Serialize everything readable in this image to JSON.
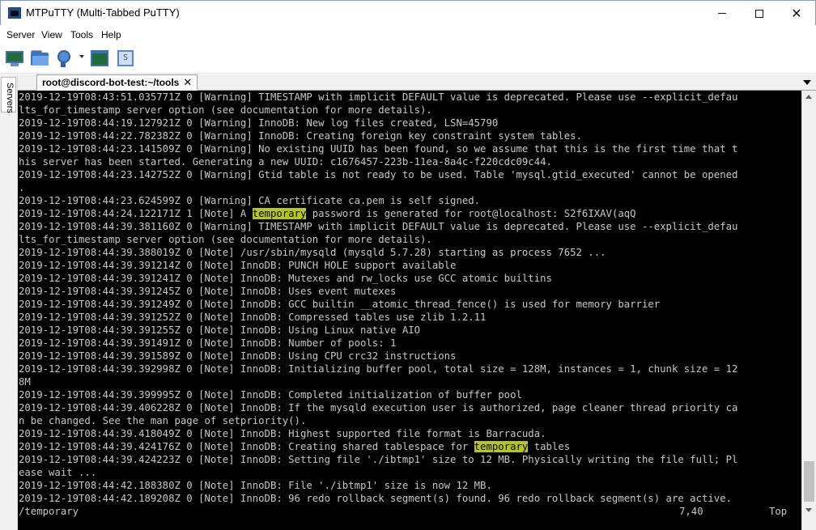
{
  "window": {
    "title": "MTPuTTY (Multi-Tabbed PuTTY)",
    "minimize_icon": "minimize-icon",
    "maximize_icon": "maximize-icon",
    "close_glyph": "✕"
  },
  "menu": {
    "items": [
      "Server",
      "View",
      "Tools",
      "Help"
    ]
  },
  "toolbar": {
    "icons": [
      "monitor-icon",
      "folder-icon",
      "connect-icon",
      "dropdown-arrow-icon",
      "terminal-icon",
      "script-icon"
    ],
    "script_glyph": "S"
  },
  "sidebar": {
    "servers_label": "Servers"
  },
  "tab": {
    "label": "root@discord-bot-test:~/tools",
    "close_glyph": "✕"
  },
  "terminal": {
    "highlight_color": "#b7c61a",
    "lines": [
      {
        "pre": "2019-12-19T08:43:51.035771Z 0 [Warning] TIMESTAMP with implicit DEFAULT value is deprecated. Please use --explicit_defau",
        "hl": "",
        "post": ""
      },
      {
        "pre": "lts_for_timestamp server option (see documentation for more details).",
        "hl": "",
        "post": ""
      },
      {
        "pre": "2019-12-19T08:44:19.127921Z 0 [Warning] InnoDB: New log files created, LSN=45790",
        "hl": "",
        "post": ""
      },
      {
        "pre": "2019-12-19T08:44:22.782382Z 0 [Warning] InnoDB: Creating foreign key constraint system tables.",
        "hl": "",
        "post": ""
      },
      {
        "pre": "2019-12-19T08:44:23.141509Z 0 [Warning] No existing UUID has been found, so we assume that this is the first time that t",
        "hl": "",
        "post": ""
      },
      {
        "pre": "his server has been started. Generating a new UUID: c1676457-223b-11ea-8a4c-f220cdc09c44.",
        "hl": "",
        "post": ""
      },
      {
        "pre": "2019-12-19T08:44:23.142752Z 0 [Warning] Gtid table is not ready to be used. Table 'mysql.gtid_executed' cannot be opened",
        "hl": "",
        "post": ""
      },
      {
        "pre": ".",
        "hl": "",
        "post": ""
      },
      {
        "pre": "2019-12-19T08:44:23.624599Z 0 [Warning] CA certificate ca.pem is self signed.",
        "hl": "",
        "post": ""
      },
      {
        "pre": "2019-12-19T08:44:24.122171Z 1 [Note] A ",
        "hl": "temporary",
        "post": " password is generated for root@localhost: S2f6IXAV(aqQ"
      },
      {
        "pre": "2019-12-19T08:44:39.381160Z 0 [Warning] TIMESTAMP with implicit DEFAULT value is deprecated. Please use --explicit_defau",
        "hl": "",
        "post": ""
      },
      {
        "pre": "lts_for_timestamp server option (see documentation for more details).",
        "hl": "",
        "post": ""
      },
      {
        "pre": "2019-12-19T08:44:39.388019Z 0 [Note] /usr/sbin/mysqld (mysqld 5.7.28) starting as process 7652 ...",
        "hl": "",
        "post": ""
      },
      {
        "pre": "2019-12-19T08:44:39.391214Z 0 [Note] InnoDB: PUNCH HOLE support available",
        "hl": "",
        "post": ""
      },
      {
        "pre": "2019-12-19T08:44:39.391241Z 0 [Note] InnoDB: Mutexes and rw_locks use GCC atomic builtins",
        "hl": "",
        "post": ""
      },
      {
        "pre": "2019-12-19T08:44:39.391245Z 0 [Note] InnoDB: Uses event mutexes",
        "hl": "",
        "post": ""
      },
      {
        "pre": "2019-12-19T08:44:39.391249Z 0 [Note] InnoDB: GCC builtin __atomic_thread_fence() is used for memory barrier",
        "hl": "",
        "post": ""
      },
      {
        "pre": "2019-12-19T08:44:39.391252Z 0 [Note] InnoDB: Compressed tables use zlib 1.2.11",
        "hl": "",
        "post": ""
      },
      {
        "pre": "2019-12-19T08:44:39.391255Z 0 [Note] InnoDB: Using Linux native AIO",
        "hl": "",
        "post": ""
      },
      {
        "pre": "2019-12-19T08:44:39.391491Z 0 [Note] InnoDB: Number of pools: 1",
        "hl": "",
        "post": ""
      },
      {
        "pre": "2019-12-19T08:44:39.391589Z 0 [Note] InnoDB: Using CPU crc32 instructions",
        "hl": "",
        "post": ""
      },
      {
        "pre": "2019-12-19T08:44:39.392998Z 0 [Note] InnoDB: Initializing buffer pool, total size = 128M, instances = 1, chunk size = 12",
        "hl": "",
        "post": ""
      },
      {
        "pre": "8M",
        "hl": "",
        "post": ""
      },
      {
        "pre": "2019-12-19T08:44:39.399995Z 0 [Note] InnoDB: Completed initialization of buffer pool",
        "hl": "",
        "post": ""
      },
      {
        "pre": "2019-12-19T08:44:39.406228Z 0 [Note] InnoDB: If the mysqld execution user is authorized, page cleaner thread priority ca",
        "hl": "",
        "post": ""
      },
      {
        "pre": "n be changed. See the man page of setpriority().",
        "hl": "",
        "post": ""
      },
      {
        "pre": "2019-12-19T08:44:39.418049Z 0 [Note] InnoDB: Highest supported file format is Barracuda.",
        "hl": "",
        "post": ""
      },
      {
        "pre": "2019-12-19T08:44:39.424176Z 0 [Note] InnoDB: Creating shared tablespace for ",
        "hl": "temporary",
        "post": " tables"
      },
      {
        "pre": "2019-12-19T08:44:39.424223Z 0 [Note] InnoDB: Setting file './ibtmp1' size to 12 MB. Physically writing the file full; Pl",
        "hl": "",
        "post": ""
      },
      {
        "pre": "ease wait ...",
        "hl": "",
        "post": ""
      },
      {
        "pre": "2019-12-19T08:44:42.188380Z 0 [Note] InnoDB: File './ibtmp1' size is now 12 MB.",
        "hl": "",
        "post": ""
      },
      {
        "pre": "2019-12-19T08:44:42.189208Z 0 [Note] InnoDB: 96 redo rollback segment(s) found. 96 redo rollback segment(s) are active.",
        "hl": "",
        "post": ""
      },
      {
        "pre": "/temporary",
        "hl": "",
        "post": ""
      }
    ],
    "status": {
      "position": "7,40",
      "scroll": "Top"
    }
  },
  "scrollbar": {
    "up_icon": "scroll-up-arrow-icon",
    "down_icon": "scroll-down-arrow-icon"
  }
}
